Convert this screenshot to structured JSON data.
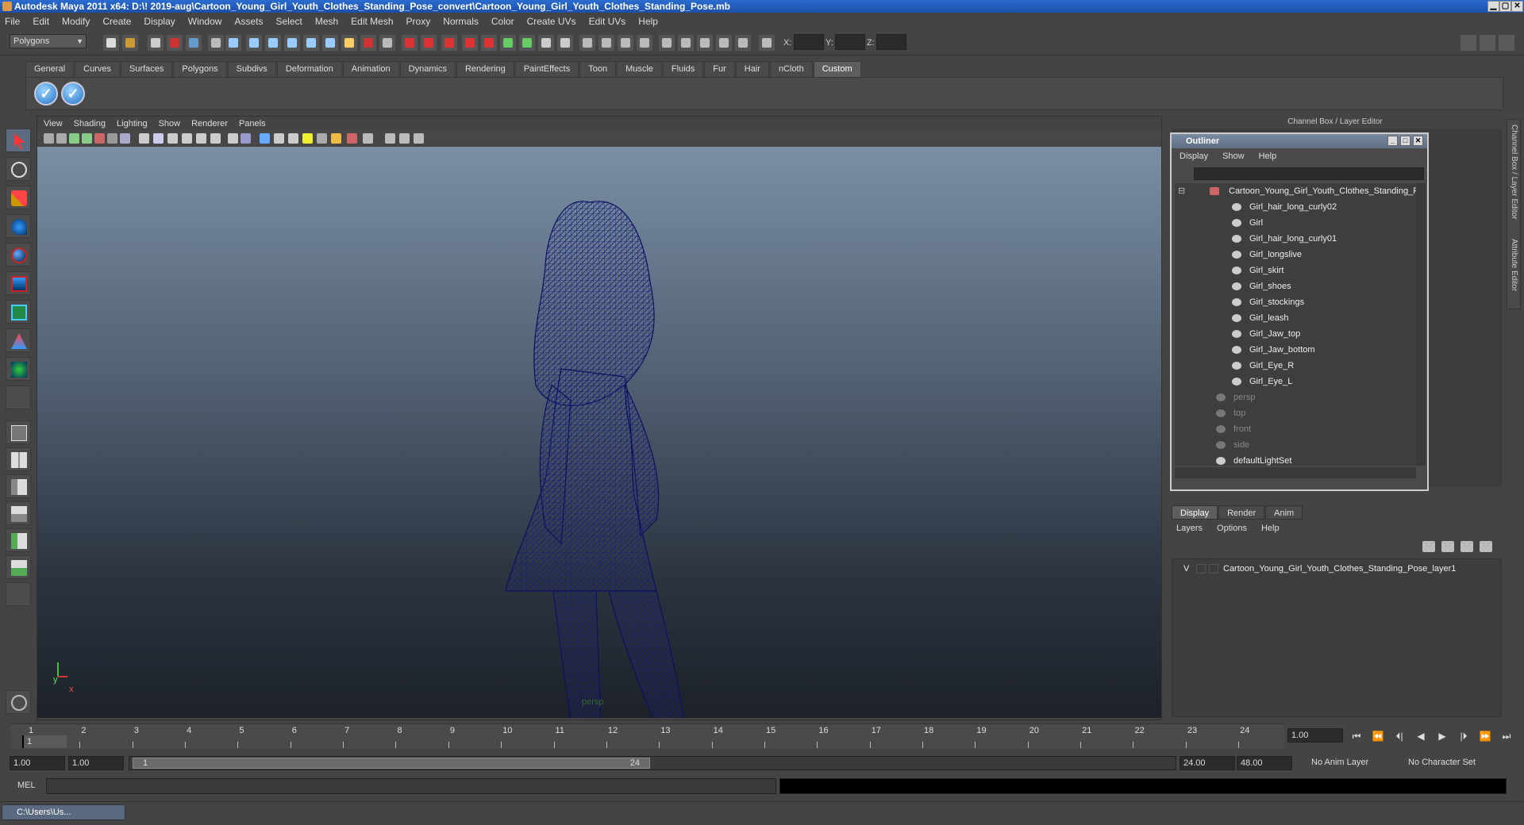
{
  "title": "Autodesk Maya 2011 x64: D:\\! 2019-aug\\Cartoon_Young_Girl_Youth_Clothes_Standing_Pose_convert\\Cartoon_Young_Girl_Youth_Clothes_Standing_Pose.mb",
  "window_controls": [
    "▁",
    "▢",
    "✕"
  ],
  "menu": [
    "File",
    "Edit",
    "Modify",
    "Create",
    "Display",
    "Window",
    "Assets",
    "Select",
    "Mesh",
    "Edit Mesh",
    "Proxy",
    "Normals",
    "Color",
    "Create UVs",
    "Edit UVs",
    "Help"
  ],
  "statusline": {
    "mode": "Polygons",
    "x_label": "X:",
    "y_label": "Y:",
    "z_label": "Z:"
  },
  "shelf_tabs": [
    "General",
    "Curves",
    "Surfaces",
    "Polygons",
    "Subdivs",
    "Deformation",
    "Animation",
    "Dynamics",
    "Rendering",
    "PaintEffects",
    "Toon",
    "Muscle",
    "Fluids",
    "Fur",
    "Hair",
    "nCloth",
    "Custom"
  ],
  "shelf_active": "Custom",
  "viewport": {
    "menu": [
      "View",
      "Shading",
      "Lighting",
      "Show",
      "Renderer",
      "Panels"
    ],
    "camera_label": "persp",
    "axis_y": "y",
    "axis_x": "x"
  },
  "channel_box": {
    "title": "Channel Box / Layer Editor",
    "side_tab_1": "Channel Box / Layer Editor",
    "side_tab_2": "Attribute Editor"
  },
  "outliner": {
    "title": "Outliner",
    "menu": [
      "Display",
      "Show",
      "Help"
    ],
    "root": "Cartoon_Young_Girl_Youth_Clothes_Standing_F",
    "children": [
      "Girl_hair_long_curly02",
      "Girl",
      "Girl_hair_long_curly01",
      "Girl_longslive",
      "Girl_skirt",
      "Girl_shoes",
      "Girl_stockings",
      "Girl_leash",
      "Girl_Jaw_top",
      "Girl_Jaw_bottom",
      "Girl_Eye_R",
      "Girl_Eye_L"
    ],
    "cameras": [
      "persp",
      "top",
      "front",
      "side"
    ],
    "sets": [
      "defaultLightSet"
    ]
  },
  "layer_editor": {
    "tabs": [
      "Display",
      "Render",
      "Anim"
    ],
    "active_tab": "Display",
    "menu": [
      "Layers",
      "Options",
      "Help"
    ],
    "layer_visible": "V",
    "layer_name": "Cartoon_Young_Girl_Youth_Clothes_Standing_Pose_layer1"
  },
  "timeline": {
    "frames": [
      "1",
      "2",
      "3",
      "4",
      "5",
      "6",
      "7",
      "8",
      "9",
      "10",
      "11",
      "12",
      "13",
      "14",
      "15",
      "16",
      "17",
      "18",
      "19",
      "20",
      "21",
      "22",
      "23",
      "24"
    ],
    "current_frame_marker": "1",
    "current_frame": "1.00",
    "playback_buttons": [
      "⏮",
      "⏪",
      "⏴|",
      "◀",
      "▶",
      "|⏵",
      "⏩",
      "⏭"
    ]
  },
  "range": {
    "start": "1.00",
    "playback_start": "1.00",
    "slider_start": "1",
    "slider_end": "24",
    "playback_end": "24.00",
    "end": "48.00",
    "anim_layer": "No Anim Layer",
    "character_set": "No Character Set"
  },
  "command_line": {
    "label": "MEL"
  },
  "taskbar": {
    "item": "C:\\Users\\Us..."
  }
}
